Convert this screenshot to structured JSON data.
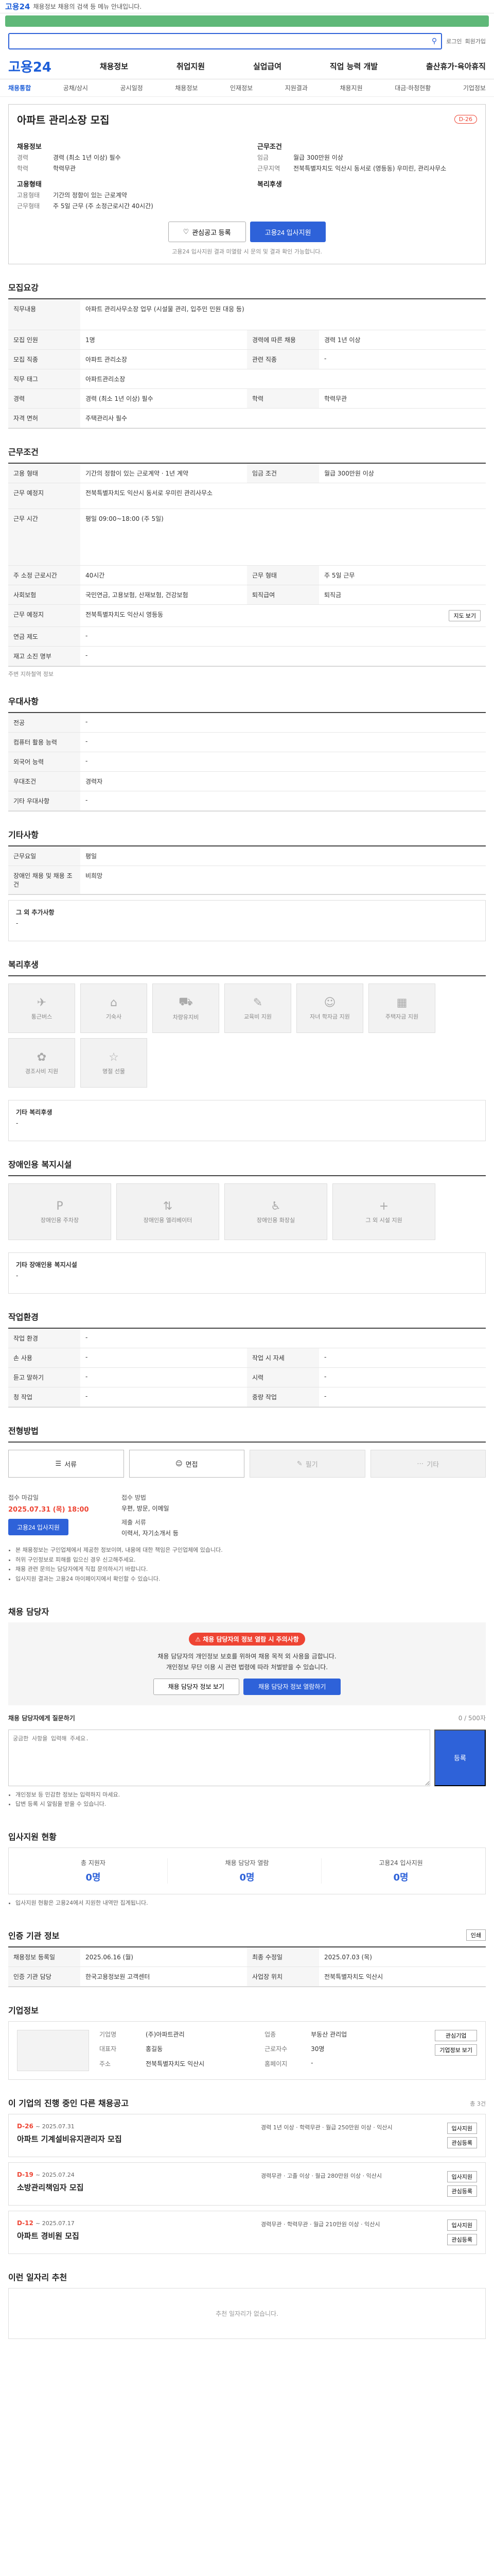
{
  "topbar": {
    "logo": "고용24",
    "note": "채용정보 채용의 검색 등 메뉴 안내입니다."
  },
  "header": {
    "brand": "고용24",
    "menus": [
      "채용정보",
      "취업지원",
      "실업급여",
      "직업 능력 개발",
      "출산휴가·육아휴직"
    ],
    "top_links": [
      "로그인",
      "회원가입"
    ]
  },
  "subnav": [
    "채용통합",
    "공채/상시",
    "공시일정",
    "채용정보",
    "인재정보",
    "지원결과",
    "채용지원",
    "대금·하청현황",
    "기업정보"
  ],
  "job": {
    "title": "아파트 관리소장 모집",
    "dday": "D-26",
    "left_label": "채용정보",
    "right_label": "근무조건",
    "left": [
      {
        "k": "경력",
        "v": "경력 (최소 1년 이상) 필수"
      },
      {
        "k": "학력",
        "v": "학력무관"
      }
    ],
    "right": [
      {
        "k": "임금",
        "v": "월급 300만원 이상"
      },
      {
        "k": "근무지역",
        "v": "전북특별자치도 익산시 동서로 (영등동) 우미린, 관리사무소"
      }
    ],
    "emp_label": "고용형태",
    "emp": [
      {
        "k": "고용형태",
        "v": "기간의 정함이 있는 근로계약"
      },
      {
        "k": "근무형태",
        "v": "주 5일 근무 (주 소정근로시간 40시간)"
      }
    ],
    "welfare_label": "복리후생",
    "btn_scrap": "관심공고 등록",
    "btn_apply": "고용24 입사지원",
    "note": "고용24 입사지원 결과 미열람 시 문의 및 결과 확인 가능합니다."
  },
  "recruit": {
    "title": "모집요강",
    "duty_label": "직무내용",
    "duty": "아파트 관리사무소장 업무 (시설물 관리, 입주민 민원 대응 등)",
    "rows": [
      [
        "모집 인원",
        "1명",
        "경력에 따른 채용",
        "경력 1년 이상"
      ],
      [
        "모집 직종",
        "아파트 관리소장",
        "관련 직종",
        "-"
      ],
      [
        "직무 태그",
        "아파트관리소장",
        "",
        ""
      ],
      [
        "경력",
        "경력 (최소 1년 이상) 필수",
        "학력",
        "학력무관"
      ]
    ],
    "license_label": "자격 면허",
    "license": "주택관리사 필수"
  },
  "cond": {
    "title": "근무조건",
    "rows": [
      [
        "고용 형태",
        "기간의 정함이 있는 근로계약 · 1년 계약",
        "임금 조건",
        "월급 300만원 이상"
      ],
      [
        "근무 예정지",
        "전북특별자치도 익산시 동서로 우미린 관리사무소",
        "",
        ""
      ],
      [
        "근무 시간",
        "평일 09:00~18:00 (주 5일)",
        "",
        ""
      ],
      [
        "주 소정 근로시간",
        "40시간",
        "근무 형태",
        "주 5일 근무"
      ],
      [
        "사회보험",
        "국민연금, 고용보험, 산재보험, 건강보험",
        "퇴직급여",
        "퇴직금"
      ],
      [
        "근무 예정지",
        "전북특별자치도 익산시 영등동",
        "",
        ""
      ]
    ],
    "extra": [
      [
        "연금 제도",
        "-"
      ],
      [
        "재고 소진 명부",
        "-"
      ]
    ],
    "near_station": "주변 지하철역 정보",
    "map_btn": "지도 보기"
  },
  "prefer": {
    "title": "우대사항",
    "rows": [
      [
        "전공",
        "-"
      ],
      [
        "컴퓨터 활용 능력",
        "-"
      ],
      [
        "외국어 능력",
        "-"
      ],
      [
        "우대조건",
        "경력자"
      ],
      [
        "기타 우대사항",
        "-"
      ]
    ]
  },
  "etc": {
    "title": "기타사항",
    "rows": [
      [
        "근무요일",
        "평일"
      ],
      [
        "장애인 채용 및 채용 조건",
        "비희망"
      ]
    ],
    "note_label": "그 외 추가사항",
    "note": "-"
  },
  "benefits": {
    "title": "복리후생",
    "items": [
      "통근버스",
      "기숙사",
      "차량유지비",
      "교육비 지원",
      "자녀 학자금 지원",
      "주택자금 지원",
      "경조사비 지원",
      "명절 선물"
    ],
    "other_label": "기타 복리후생",
    "other": "-"
  },
  "disability": {
    "title": "장애인용 복지시설",
    "items": [
      "장애인용 주차장",
      "장애인용 엘리베이터",
      "장애인용 화장실",
      "그 외 시설 지원"
    ],
    "other_label": "기타 장애인용 복지시설",
    "other": "-"
  },
  "workplace": {
    "title": "작업환경",
    "rows": [
      [
        "작업 환경",
        "-",
        "",
        ""
      ],
      [
        "손 사용",
        "-",
        "작업 시 자세",
        "-"
      ],
      [
        "듣고 말하기",
        "-",
        "시력",
        "-"
      ],
      [
        "청 작업",
        "-",
        "중량 작업",
        "-"
      ]
    ]
  },
  "apply": {
    "title": "전형방법",
    "methods": [
      {
        "label": "서류",
        "off": false
      },
      {
        "label": "면접",
        "off": false
      },
      {
        "label": "필기",
        "off": true
      },
      {
        "label": "기타",
        "off": true
      }
    ],
    "period_label": "접수 마감일",
    "period": "2025.07.31 (목) 18:00",
    "apply_btn": "고용24 입사지원",
    "method_label": "접수 방법",
    "method": "우편, 방문, 이메일",
    "docs_label": "제출 서류",
    "docs": "이력서, 자기소개서 등",
    "bullets": [
      "본 채용정보는 구인업체에서 제공한 정보이며, 내용에 대한 책임은 구인업체에 있습니다.",
      "허위 구인정보로 피해를 입으신 경우 신고해주세요.",
      "채용 관련 문의는 담당자에게 직접 문의하시기 바랍니다.",
      "입사지원 결과는 고용24 마이페이지에서 확인할 수 있습니다."
    ]
  },
  "contact": {
    "title": "채용 담당자",
    "alert": "채용 담당자의 정보 열람 시 주의사항",
    "desc1": "채용 담당자의 개인정보 보호를 위하여 채용 목적 외 사용을 금합니다.",
    "desc2": "개인정보 무단 이용 시 관련 법령에 따라 처벌받을 수 있습니다.",
    "btn_view": "채용 담당자 정보 보기",
    "btn_person": "채용 담당자 정보 열람하기",
    "qa_label": "채용 담당자에게 질문하기",
    "qa_placeholder": "궁금한 사항을 입력해 주세요.",
    "qa_btn": "등록",
    "qa_count": "0 / 500자",
    "notes": [
      "개인정보 등 민감한 정보는 입력하지 마세요.",
      "답변 등록 시 알림을 받을 수 있습니다."
    ]
  },
  "stats": {
    "title": "입사지원 현황",
    "items": [
      {
        "l": "총 지원자",
        "n": "0명"
      },
      {
        "l": "채용 담당자 열람",
        "n": "0명"
      },
      {
        "l": "고용24 입사지원",
        "n": "0명"
      }
    ],
    "note": "입사지원 현황은 고용24에서 지원한 내역만 집계됩니다."
  },
  "reg": {
    "title": "인증 기관 정보",
    "rows": [
      [
        "채용정보 등록일",
        "2025.06.16 (월)",
        "최종 수정일",
        "2025.07.03 (목)"
      ],
      [
        "인증 기관 담당",
        "한국고용정보원 고객센터",
        "사업장 위치",
        "전북특별자치도 익산시"
      ]
    ],
    "print_btn": "인쇄"
  },
  "company": {
    "title": "기업정보",
    "btn_follow": "관심기업",
    "btn_info": "기업정보 보기",
    "rows": [
      [
        "기업명",
        "(주)아파트관리",
        "업종",
        "부동산 관리업"
      ],
      [
        "대표자",
        "홍길동",
        "근로자수",
        "30명"
      ],
      [
        "주소",
        "전북특별자치도 익산시",
        "홈페이지",
        "-"
      ]
    ]
  },
  "others": {
    "title": "이 기업의 진행 중인 다른 채용공고",
    "sub": "총 3건",
    "items": [
      {
        "dd": "D-26",
        "date": "~ 2025.07.31",
        "t": "아파트 기계설비유지관리자 모집",
        "m": "경력 1년 이상 · 학력무관 · 월급 250만원 이상 · 익산시"
      },
      {
        "dd": "D-19",
        "date": "~ 2025.07.24",
        "t": "소방관리책임자 모집",
        "m": "경력무관 · 고졸 이상 · 월급 280만원 이상 · 익산시"
      },
      {
        "dd": "D-12",
        "date": "~ 2025.07.17",
        "t": "아파트 경비원 모집",
        "m": "경력무관 · 학력무관 · 월급 210만원 이상 · 익산시"
      }
    ],
    "btn_apply": "입사지원",
    "btn_scrap": "관심등록"
  },
  "recommend": {
    "title": "이런 일자리 추천",
    "empty": "추천 일자리가 없습니다."
  }
}
